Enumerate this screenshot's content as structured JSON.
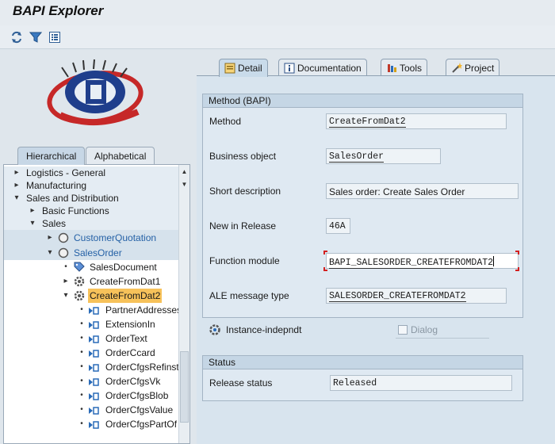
{
  "app": {
    "title": "BAPI Explorer"
  },
  "toolbar": {
    "buttons": [
      {
        "name": "refresh-icon",
        "label": "Refresh"
      },
      {
        "name": "filter-icon",
        "label": "Filter"
      },
      {
        "name": "list-icon",
        "label": "List"
      }
    ]
  },
  "left_tabs": [
    "Hierarchical",
    "Alphabetical"
  ],
  "tree": [
    {
      "label": "Logistics - General"
    },
    {
      "label": "Manufacturing"
    },
    {
      "label": "Sales and Distribution"
    },
    {
      "label": "Basic Functions"
    },
    {
      "label": "Sales"
    },
    {
      "label": "CustomerQuotation"
    },
    {
      "label": "SalesOrder"
    },
    {
      "label": "SalesDocument"
    },
    {
      "label": "CreateFromDat1"
    },
    {
      "label": "CreateFromDat2"
    },
    {
      "label": "PartnerAddresses"
    },
    {
      "label": "ExtensionIn"
    },
    {
      "label": "OrderText"
    },
    {
      "label": "OrderCcard"
    },
    {
      "label": "OrderCfgsRefinst"
    },
    {
      "label": "OrderCfgsVk"
    },
    {
      "label": "OrderCfgsBlob"
    },
    {
      "label": "OrderCfgsValue"
    },
    {
      "label": "OrderCfgsPartOf"
    }
  ],
  "right_tabs": [
    {
      "label": "Detail",
      "icon": "detail-icon"
    },
    {
      "label": "Documentation",
      "icon": "info-icon"
    },
    {
      "label": "Tools",
      "icon": "tools-icon"
    },
    {
      "label": "Project",
      "icon": "wand-icon"
    }
  ],
  "method_group": {
    "title": "Method (BAPI)",
    "fields": [
      {
        "label": "Method",
        "value": "CreateFromDat2"
      },
      {
        "label": "Business object",
        "value": "SalesOrder"
      },
      {
        "label": "Short description",
        "value": "Sales order: Create Sales Order"
      },
      {
        "label": "New in Release",
        "value": "46A"
      },
      {
        "label": "Function module",
        "value": "BAPI_SALESORDER_CREATEFROMDAT2"
      },
      {
        "label": "ALE message type",
        "value": "SALESORDER_CREATEFROMDAT2"
      }
    ],
    "instance_label": "Instance-indepndt",
    "dialog_label": "Dialog"
  },
  "status_group": {
    "title": "Status",
    "release_label": "Release status",
    "release_value": "Released"
  },
  "colors": {
    "accent_selected": "#f7c25a",
    "link_blue": "#2561a6",
    "error_corner": "#d32020"
  }
}
